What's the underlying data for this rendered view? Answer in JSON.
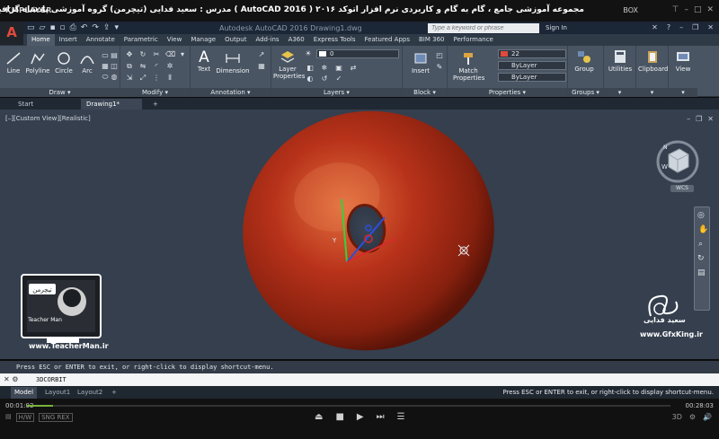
{
  "player": {
    "logo": "KMPLAYER",
    "title": "مجموعه آموزشی جامع ، گام به گام و کاربردی نرم افزار  اتوکد ۲۰۱۶ ( AutoCAD  2016 )  مدرس : سعید فدایی (تیچرمن) گروه آموزشی پادشاه گرافیست ها",
    "box_label": "BOX",
    "current_time": "00:01:03",
    "total_time": "00:28:03",
    "progress": 0.04,
    "hw_label1": "H/W",
    "hw_label2": "SNG REX"
  },
  "acad": {
    "app_letter": "A",
    "document_title": "Autodesk AutoCAD 2016    Drawing1.dwg",
    "search_placeholder": "Type a keyword or phrase",
    "sign_in": "Sign In",
    "ribbon_tabs": [
      "Home",
      "Insert",
      "Annotate",
      "Parametric",
      "View",
      "Manage",
      "Output",
      "Add-ins",
      "A360",
      "Express Tools",
      "Featured Apps",
      "BIM 360",
      "Performance"
    ],
    "active_tab": "Home",
    "panels": {
      "draw": "Draw",
      "modify": "Modify",
      "annotation": "Annotation",
      "layers": "Layers",
      "block": "Block",
      "properties": "Properties",
      "groups": "Groups"
    },
    "tools": {
      "line": "Line",
      "polyline": "Polyline",
      "circle": "Circle",
      "arc": "Arc",
      "text": "Text",
      "dimension": "Dimension",
      "layer_properties_1": "Layer",
      "layer_properties_2": "Properties",
      "insert": "Insert",
      "match_properties_1": "Match",
      "match_properties_2": "Properties",
      "group": "Group",
      "utilities": "Utilities",
      "clipboard": "Clipboard",
      "view": "View"
    },
    "layer_value": "0",
    "color_value": "22",
    "linetype_value": "ByLayer",
    "lineweight_value": "ByLayer",
    "colors": {
      "accent_red": "#e04a3c",
      "torus": "#b8321a",
      "viewport_bg": "#353f4e"
    },
    "file_tabs": [
      "Start",
      "Drawing1*"
    ],
    "viewport_label": "[–][Custom View][Realistic]",
    "wcs_label": "WCS",
    "command_history": "Press ESC or ENTER to exit, or right-click to display shortcut-menu.",
    "command_input": "3DCORBIT",
    "layout_tabs": [
      "Model",
      "Layout1",
      "Layout2"
    ],
    "status_message": "Press ESC or ENTER to exit, or right-click to display shortcut-menu."
  },
  "overlay": {
    "logo_word": "تیچرمن",
    "logo_sub": "Teacher Man",
    "site_left": "www.TeacherMan.ir",
    "signature": "سعید فدایی",
    "site_right": "www.GfxKing.ir"
  }
}
